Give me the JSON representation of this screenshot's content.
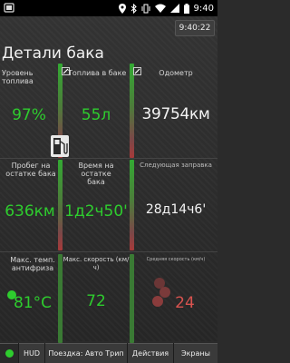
{
  "status_bar": {
    "time": "9:40"
  },
  "header": {
    "clock": "9:40:22",
    "title": "Детали бака"
  },
  "cells": {
    "tank_level": {
      "label": "Уровень топлива",
      "value": "97%"
    },
    "fuel_in_tank": {
      "label": "Топлива в баке",
      "value": "55л"
    },
    "odometer": {
      "label": "Одометр",
      "value": "39754км"
    },
    "range_on_tank": {
      "label": "Пробег на остатке бака",
      "value": "636км"
    },
    "time_on_tank": {
      "label": "Время на остатке бака",
      "value": "1д2ч50'"
    },
    "next_refuel": {
      "label": "Следующая заправка",
      "value": "28д14ч6'"
    },
    "max_coolant_temp": {
      "label": "Макс. темп. антифриза",
      "value": "81°C"
    },
    "max_speed": {
      "label": "Макс. скорость (км/ч)",
      "value": "72"
    },
    "avg_speed": {
      "label": "Средняя скорость (км/ч)",
      "value": "24"
    }
  },
  "nav": {
    "hud": "HUD",
    "trip": "Поездка: Авто Трип",
    "actions": "Действия",
    "screens": "Экраны"
  },
  "colors": {
    "accent_green": "#2ecc2e",
    "value_red": "#d9534f"
  },
  "icons": [
    "android-icon",
    "location-icon",
    "bluetooth-icon",
    "vibrate-icon",
    "wifi-icon",
    "signal-icon",
    "battery-icon",
    "fuel-pump-icon",
    "edit-icon"
  ]
}
